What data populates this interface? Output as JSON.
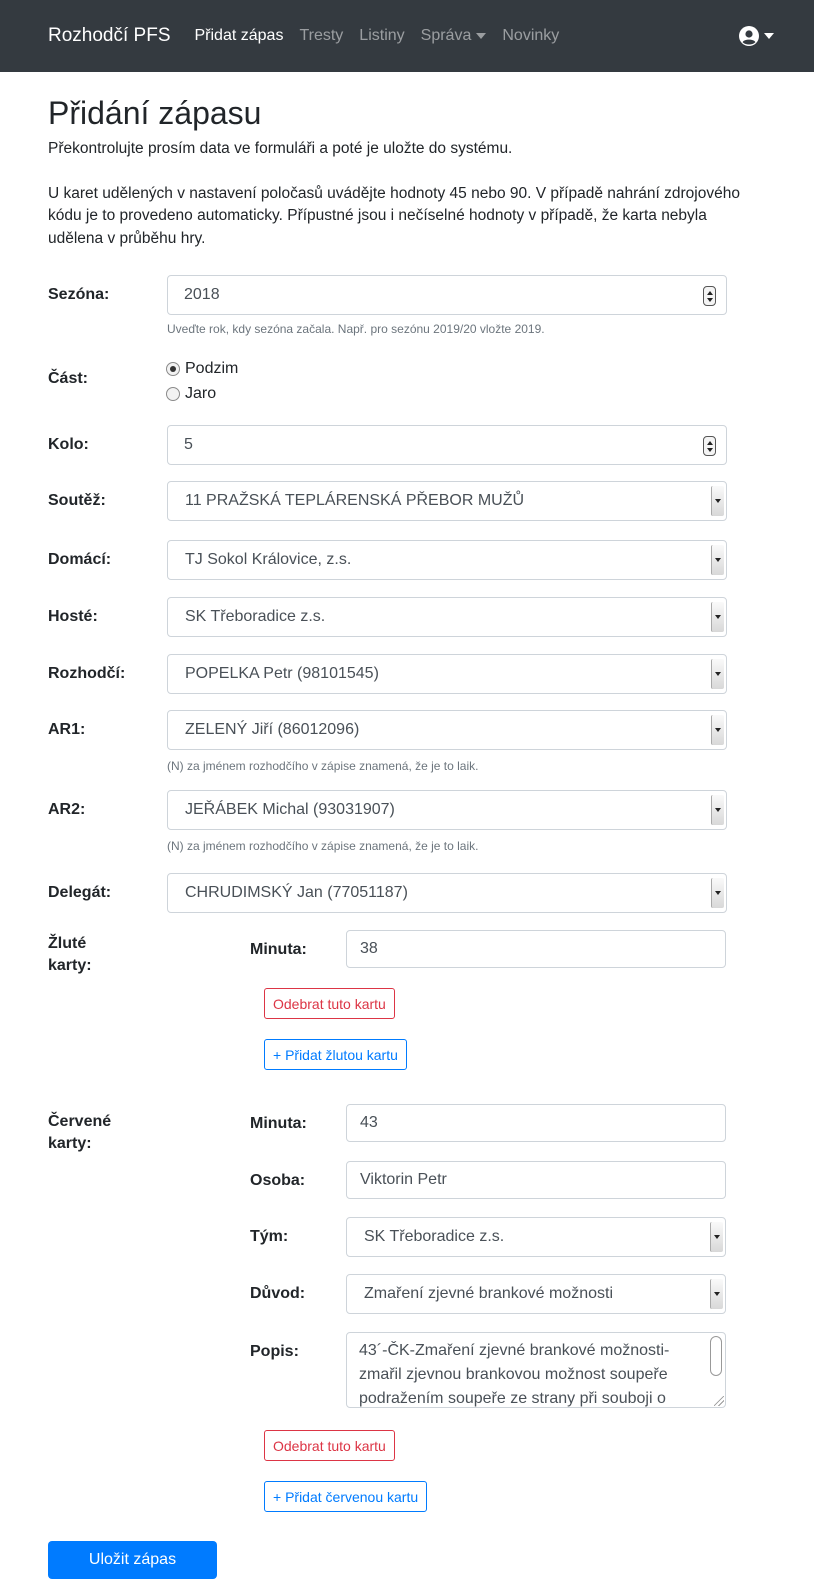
{
  "navbar": {
    "brand": "Rozhodčí PFS",
    "items": [
      {
        "label": "Přidat zápas",
        "active": true
      },
      {
        "label": "Tresty"
      },
      {
        "label": "Listiny"
      },
      {
        "label": "Správa",
        "dropdown": true
      },
      {
        "label": "Novinky"
      }
    ]
  },
  "page": {
    "title": "Přidání zápasu",
    "intro": "Překontrolujte prosím data ve formuláři a poté je uložte do systému.",
    "info": "U karet udělených v nastavení poločasů uvádějte hodnoty 45 nebo 90. V případě nahrání zdrojového kódu je to provedeno automaticky. Přípustné jsou i nečíselné hodnoty v případě, že karta nebyla udělena v průběhu hry."
  },
  "form": {
    "season": {
      "label": "Sezóna:",
      "value": "2018",
      "help": "Uveďte rok, kdy sezóna začala. Např. pro sezónu 2019/20 vložte 2019."
    },
    "part": {
      "label": "Část:",
      "options": [
        "Podzim",
        "Jaro"
      ],
      "selected": "Podzim"
    },
    "round": {
      "label": "Kolo:",
      "value": "5"
    },
    "competition": {
      "label": "Soutěž:",
      "value": "11 PRAŽSKÁ TEPLÁRENSKÁ PŘEBOR MUŽŮ"
    },
    "home": {
      "label": "Domácí:",
      "value": "TJ Sokol Královice, z.s."
    },
    "away": {
      "label": "Hosté:",
      "value": "SK Třeboradice z.s."
    },
    "referee": {
      "label": "Rozhodčí:",
      "value": "POPELKA Petr (98101545)"
    },
    "ar1": {
      "label": "AR1:",
      "value": "ZELENÝ Jiří (86012096)",
      "help": "(N) za jménem rozhodčího v zápise znamená, že je to laik."
    },
    "ar2": {
      "label": "AR2:",
      "value": "JEŘÁBEK Michal (93031907)",
      "help": "(N) za jménem rozhodčího v zápise znamená, že je to laik."
    },
    "delegate": {
      "label": "Delegát:",
      "value": "CHRUDIMSKÝ Jan (77051187)"
    }
  },
  "yellow_cards": {
    "label": "Žluté karty:",
    "minute_label": "Minuta:",
    "minute_value": "38",
    "remove_button": "Odebrat tuto kartu",
    "add_button": "+ Přidat žlutou kartu"
  },
  "red_cards": {
    "label": "Červené karty:",
    "minute_label": "Minuta:",
    "minute_value": "43",
    "person_label": "Osoba:",
    "person_value": "Viktorin Petr",
    "team_label": "Tým:",
    "team_value": "SK Třeboradice z.s.",
    "reason_label": "Důvod:",
    "reason_value": "Zmaření zjevné brankové možnosti",
    "description_label": "Popis:",
    "description_value": "43´-ČK-Zmaření zjevné brankové možnosti-zmařil zjevnou brankovou možnost soupeře podražením soupeře ze strany při souboji o",
    "remove_button": "Odebrat tuto kartu",
    "add_button": "+ Přidat červenou kartu"
  },
  "save_button": "Uložit zápas",
  "colors": {
    "navbar": "#343a40",
    "primary": "#007bff",
    "danger": "#dc3545"
  }
}
